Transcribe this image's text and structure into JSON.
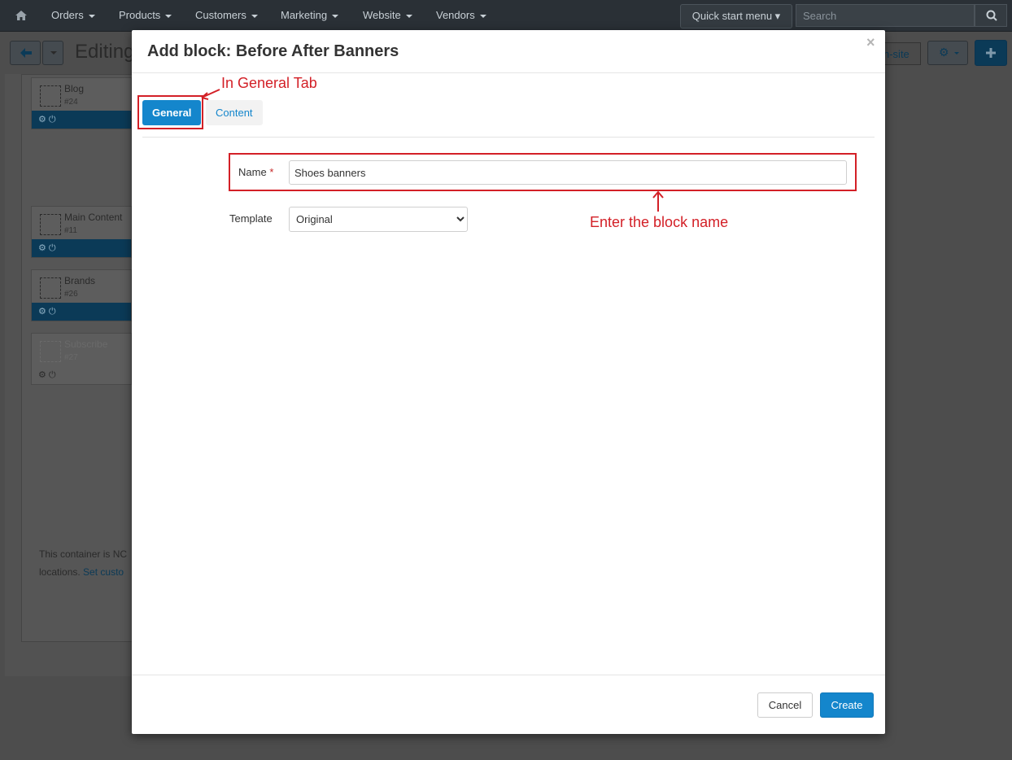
{
  "topbar": {
    "menu": [
      {
        "label": "Orders"
      },
      {
        "label": "Products"
      },
      {
        "label": "Customers"
      },
      {
        "label": "Marketing"
      },
      {
        "label": "Website"
      },
      {
        "label": "Vendors"
      }
    ],
    "quick_start": "Quick start menu",
    "search_placeholder": "Search"
  },
  "page": {
    "title": "Editing",
    "right_link": "n-site",
    "blocks": [
      {
        "name": "Blog",
        "id": "#24"
      },
      {
        "name": "Main Content",
        "id": "#11"
      },
      {
        "name": "Brands",
        "id": "#26"
      },
      {
        "name": "Subscribe",
        "id": "#27"
      }
    ],
    "container_note": {
      "text": "This container is NC",
      "text2": "locations.",
      "link": "Set custo"
    }
  },
  "modal": {
    "title": "Add block: Before After Banners",
    "close": "×",
    "tabs": [
      {
        "label": "General",
        "active": true
      },
      {
        "label": "Content",
        "active": false
      }
    ],
    "form": {
      "name_label": "Name",
      "required_mark": "*",
      "name_value": "Shoes banners",
      "template_label": "Template",
      "template_selected": "Original"
    },
    "footer": {
      "cancel": "Cancel",
      "create": "Create"
    }
  },
  "annotations": {
    "tab_note": "In General Tab",
    "name_note": "Enter the block name"
  },
  "colors": {
    "accent": "#1486cc",
    "annotation": "#d32027",
    "overlay_bg": "#4d4d4d"
  }
}
